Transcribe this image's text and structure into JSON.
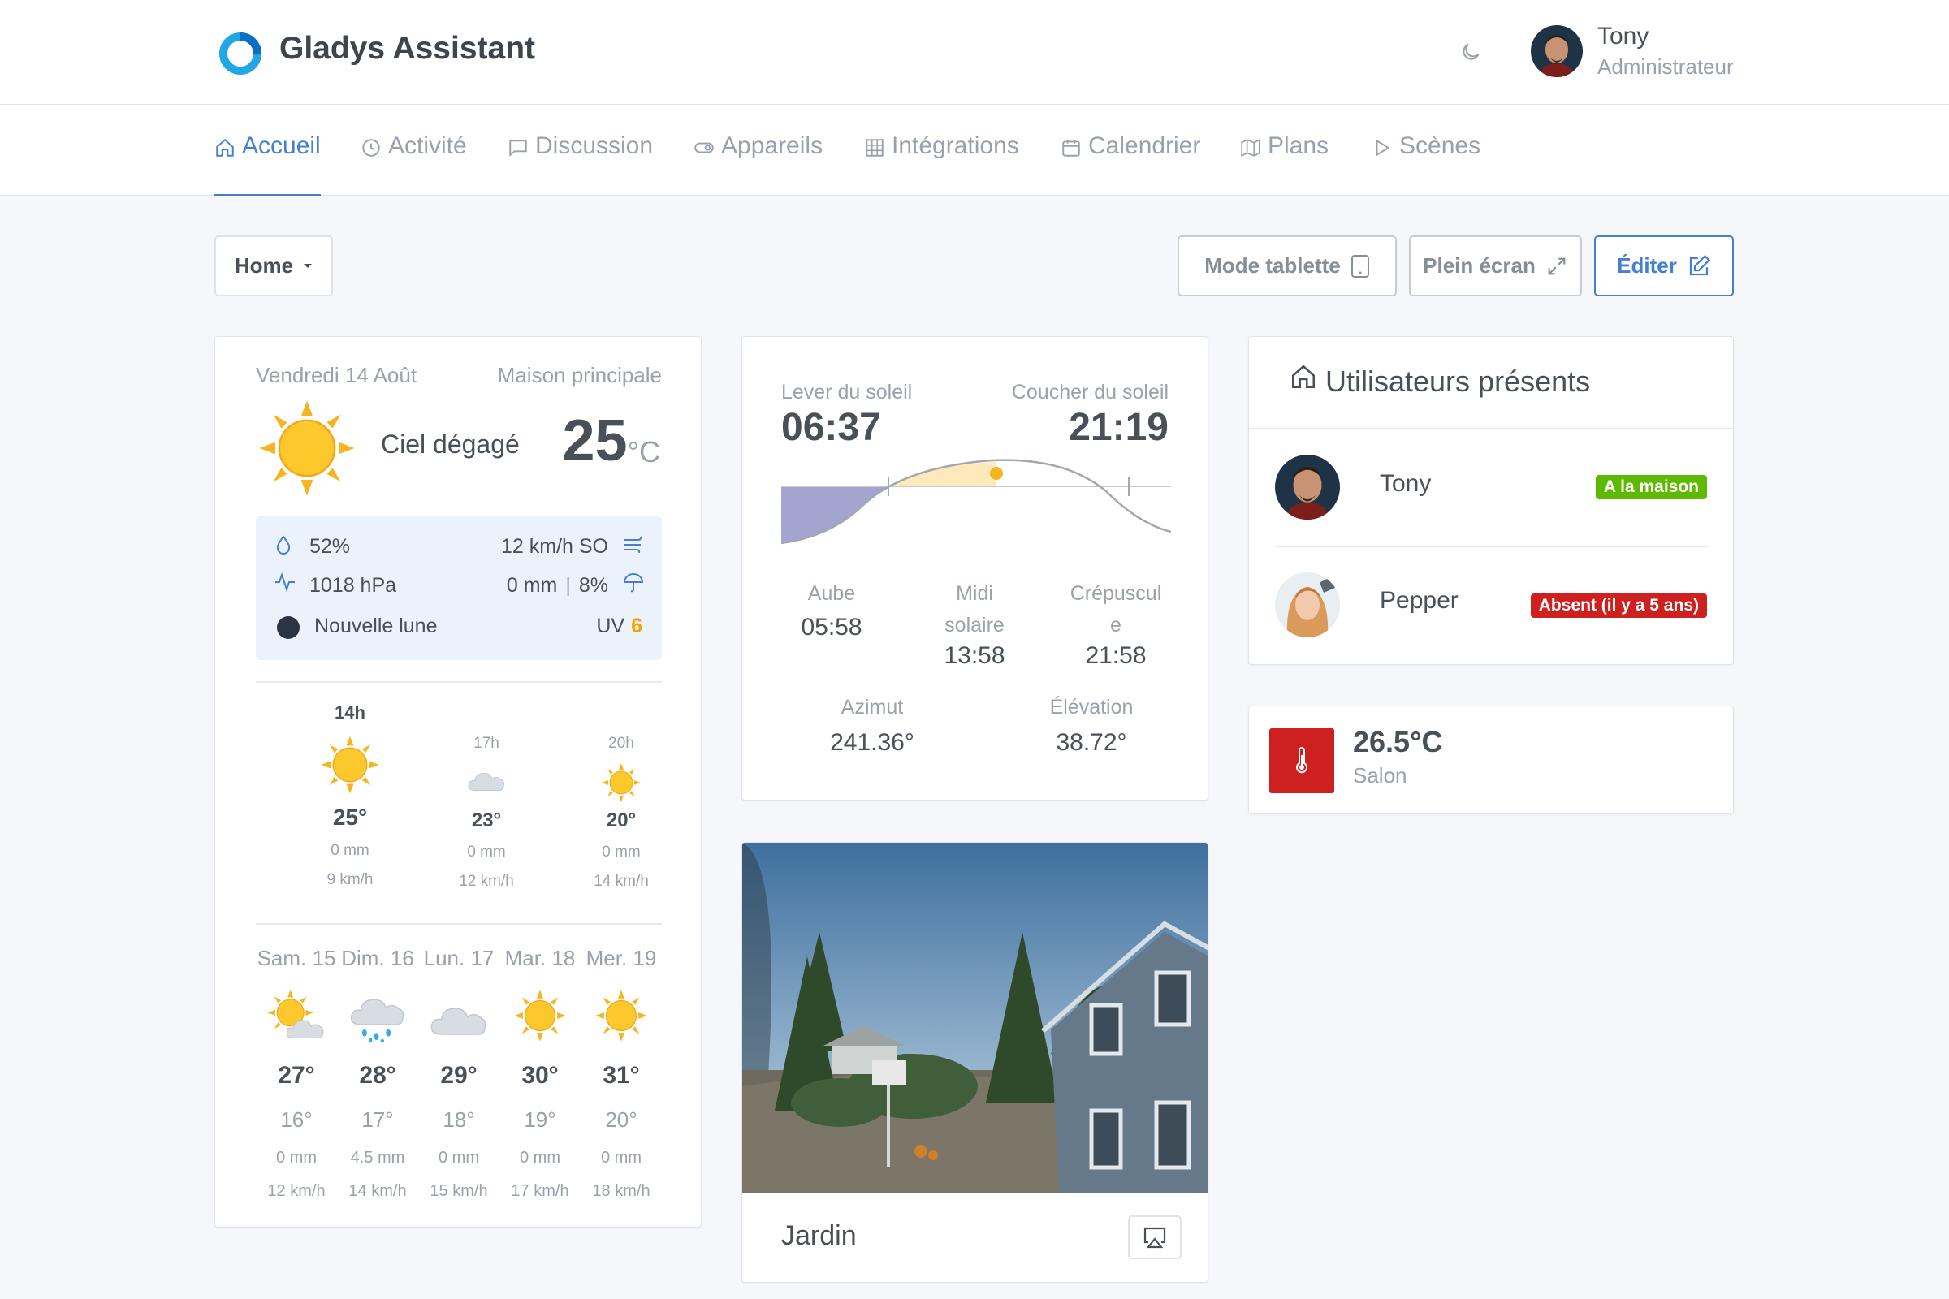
{
  "app": {
    "title": "Gladys Assistant"
  },
  "user": {
    "name": "Tony",
    "role": "Administrateur"
  },
  "nav": {
    "items": [
      {
        "label": "Accueil"
      },
      {
        "label": "Activité"
      },
      {
        "label": "Discussion"
      },
      {
        "label": "Appareils"
      },
      {
        "label": "Intégrations"
      },
      {
        "label": "Calendrier"
      },
      {
        "label": "Plans"
      },
      {
        "label": "Scènes"
      }
    ]
  },
  "toolbar": {
    "dashboard": "Home",
    "tablet_label": "Mode tablette",
    "fullscreen_label": "Plein écran",
    "edit_label": "Éditer"
  },
  "weather": {
    "date": "Vendredi 14 Août",
    "house": "Maison principale",
    "condition": "Ciel dégagé",
    "temperature": "25",
    "unit": "°C",
    "humidity": "52%",
    "wind": "12 km/h SO",
    "pressure": "1018 hPa",
    "precipitation": "0 mm",
    "precipitation_separator": "|",
    "precipitation_probability": "8%",
    "moon": "Nouvelle lune",
    "uv_label": "UV",
    "uv_value": "6",
    "hours": [
      {
        "time": "14h",
        "temp": "25°",
        "rain": "0 mm",
        "wind": "9 km/h",
        "icon": "sun-icon"
      },
      {
        "time": "17h",
        "temp": "23°",
        "rain": "0 mm",
        "wind": "12 km/h",
        "icon": "cloud-icon"
      },
      {
        "time": "20h",
        "temp": "20°",
        "rain": "0 mm",
        "wind": "14 km/h",
        "icon": "sun-icon"
      }
    ],
    "days": [
      {
        "day": "Sam. 15",
        "max": "27°",
        "min": "16°",
        "rain": "0 mm",
        "wind": "12 km/h",
        "icon": "sun-cloud-icon"
      },
      {
        "day": "Dim. 16",
        "max": "28°",
        "min": "17°",
        "rain": "4.5 mm",
        "wind": "14 km/h",
        "icon": "rain-icon"
      },
      {
        "day": "Lun. 17",
        "max": "29°",
        "min": "18°",
        "rain": "0 mm",
        "wind": "15 km/h",
        "icon": "cloud-icon"
      },
      {
        "day": "Mar. 18",
        "max": "30°",
        "min": "19°",
        "rain": "0 mm",
        "wind": "17 km/h",
        "icon": "sun-icon"
      },
      {
        "day": "Mer. 19",
        "max": "31°",
        "min": "20°",
        "rain": "0 mm",
        "wind": "18 km/h",
        "icon": "sun-icon"
      }
    ]
  },
  "sun": {
    "sunrise_label": "Lever du soleil",
    "sunrise": "06:37",
    "sunset_label": "Coucher du soleil",
    "sunset": "21:19",
    "dawn_label": "Aube",
    "dawn": "05:58",
    "noon_label_1": "Midi",
    "noon_label_2": "solaire",
    "noon": "13:58",
    "dusk_label_1": "Crépuscul",
    "dusk_label_2": "e",
    "dusk": "21:58",
    "azimuth_label": "Azimut",
    "azimuth": "241.36°",
    "elevation_label": "Élévation",
    "elevation": "38.72°"
  },
  "camera": {
    "name": "Jardin"
  },
  "users_present": {
    "title": "Utilisateurs présents",
    "users": [
      {
        "name": "Tony",
        "status": "A la maison",
        "status_color": "#5eba00"
      },
      {
        "name": "Pepper",
        "status": "Absent (il y a 5 ans)",
        "status_color": "#cd201f"
      }
    ]
  },
  "temperature_sensor": {
    "value": "26.5°C",
    "room": "Salon",
    "color": "#cd201f"
  },
  "colors": {
    "accent": "#467fcf",
    "muted": "#9aa0ac",
    "sun": "#f6b51e"
  }
}
